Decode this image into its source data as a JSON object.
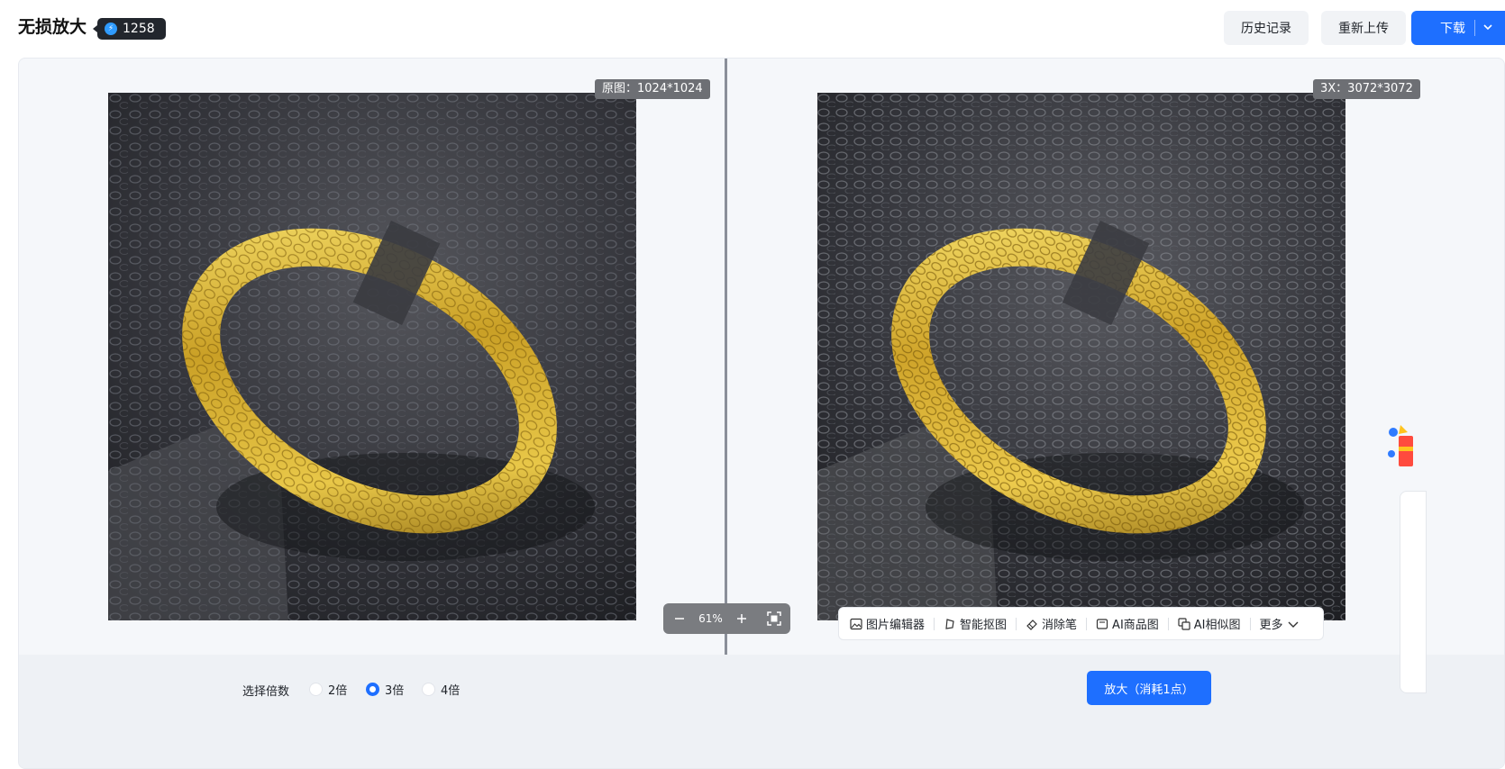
{
  "header": {
    "title": "无损放大",
    "credits": "1258",
    "history_label": "历史记录",
    "reupload_label": "重新上传",
    "download_label": "下载"
  },
  "preview": {
    "original_tag": "原图：1024*1024",
    "result_tag": "3X：3072*3072",
    "zoom_value": "61%"
  },
  "tools": [
    {
      "label": "图片编辑器",
      "icon": "image-icon"
    },
    {
      "label": "智能抠图",
      "icon": "cutout-icon"
    },
    {
      "label": "消除笔",
      "icon": "eraser-icon"
    },
    {
      "label": "AI商品图",
      "icon": "product-icon"
    },
    {
      "label": "AI相似图",
      "icon": "similar-icon"
    },
    {
      "label": "更多",
      "icon": "chevron-down-icon"
    }
  ],
  "footer": {
    "scale_label": "选择倍数",
    "options": [
      "2倍",
      "3倍",
      "4倍"
    ],
    "selected": "3倍",
    "enlarge_label": "放大（消耗1点）"
  },
  "colors": {
    "accent": "#1e6fff",
    "badge_bg": "#22262d",
    "panel_bg": "#f5f7fa"
  }
}
